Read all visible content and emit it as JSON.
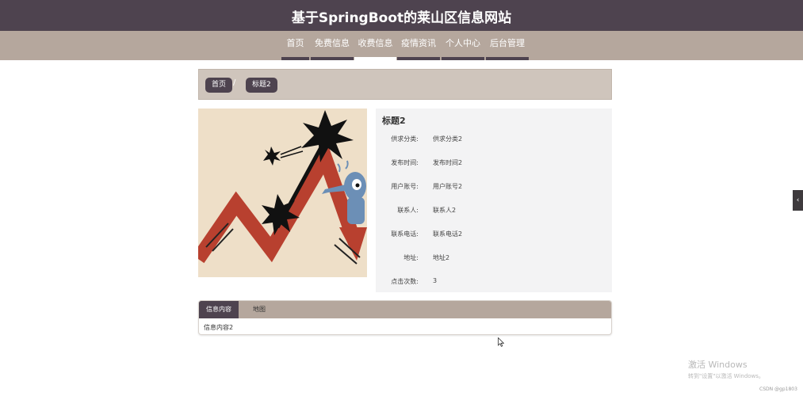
{
  "site": {
    "title": "基于SpringBoot的莱山区信息网站"
  },
  "nav": {
    "items": [
      {
        "label": "首页"
      },
      {
        "label": "免费信息"
      },
      {
        "label": "收费信息"
      },
      {
        "label": "疫情资讯"
      },
      {
        "label": "个人中心"
      },
      {
        "label": "后台管理"
      }
    ],
    "active": "收费信息"
  },
  "breadcrumb": {
    "home": "首页",
    "separator": "/",
    "current": "标题2"
  },
  "detail": {
    "title": "标题2",
    "fields": [
      {
        "label": "供求分类:",
        "value": "供求分类2"
      },
      {
        "label": "发布时间:",
        "value": "发布时间2"
      },
      {
        "label": "用户账号:",
        "value": "用户账号2"
      },
      {
        "label": "联系人:",
        "value": "联系人2"
      },
      {
        "label": "联系电话:",
        "value": "联系电话2"
      },
      {
        "label": "地址:",
        "value": "地址2"
      },
      {
        "label": "点击次数:",
        "value": "3"
      }
    ]
  },
  "tabs": {
    "items": [
      {
        "label": "信息内容"
      },
      {
        "label": "地图"
      }
    ],
    "active": "信息内容",
    "content": "信息内容2"
  },
  "side_handle": {
    "icon": "chevron-left-icon",
    "glyph": "‹"
  },
  "watermark": {
    "line1": "激活 Windows",
    "line2": "转到\"设置\"以激活 Windows。"
  },
  "credit": "CSDN @gp1803",
  "colors": {
    "header": "#4e434f",
    "nav": "#b5a79d",
    "crumbs": "#cfc5bc",
    "info_panel": "#f3f3f4",
    "accent": "#4e434f"
  }
}
